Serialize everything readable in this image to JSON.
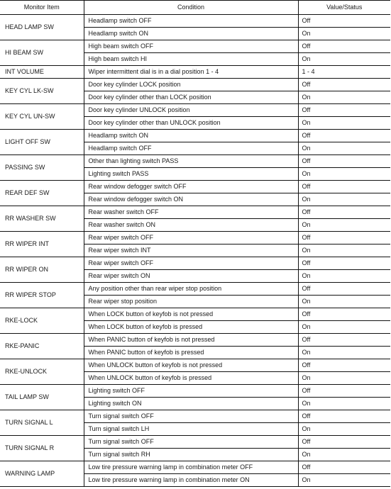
{
  "table": {
    "headers": [
      "Monitor Item",
      "Condition",
      "Value/Status"
    ],
    "groups": [
      {
        "item": "HEAD LAMP SW",
        "rows": [
          {
            "condition": "Headlamp switch OFF",
            "value": "Off"
          },
          {
            "condition": "Headlamp switch ON",
            "value": "On"
          }
        ]
      },
      {
        "item": "HI BEAM SW",
        "rows": [
          {
            "condition": "High beam switch OFF",
            "value": "Off"
          },
          {
            "condition": "High beam switch HI",
            "value": "On"
          }
        ]
      },
      {
        "item": "INT VOLUME",
        "rows": [
          {
            "condition": "Wiper intermittent dial is in a dial position 1 - 4",
            "value": "1 - 4"
          }
        ]
      },
      {
        "item": "KEY CYL LK-SW",
        "rows": [
          {
            "condition": "Door key cylinder LOCK position",
            "value": "Off"
          },
          {
            "condition": "Door key cylinder other than LOCK position",
            "value": "On"
          }
        ]
      },
      {
        "item": "KEY CYL UN-SW",
        "rows": [
          {
            "condition": "Door key cylinder UNLOCK position",
            "value": "Off"
          },
          {
            "condition": "Door key cylinder other than UNLOCK position",
            "value": "On"
          }
        ]
      },
      {
        "item": "LIGHT OFF SW",
        "rows": [
          {
            "condition": "Headlamp switch ON",
            "value": "Off"
          },
          {
            "condition": "Headlamp switch OFF",
            "value": "On"
          }
        ]
      },
      {
        "item": "PASSING SW",
        "rows": [
          {
            "condition": "Other than lighting switch PASS",
            "value": "Off"
          },
          {
            "condition": "Lighting switch PASS",
            "value": "On"
          }
        ]
      },
      {
        "item": "REAR DEF SW",
        "rows": [
          {
            "condition": "Rear window defogger switch OFF",
            "value": "Off"
          },
          {
            "condition": "Rear window defogger switch ON",
            "value": "On"
          }
        ]
      },
      {
        "item": "RR WASHER SW",
        "rows": [
          {
            "condition": "Rear washer switch OFF",
            "value": "Off"
          },
          {
            "condition": "Rear washer switch ON",
            "value": "On"
          }
        ]
      },
      {
        "item": "RR WIPER INT",
        "rows": [
          {
            "condition": "Rear wiper switch OFF",
            "value": "Off"
          },
          {
            "condition": "Rear wiper switch INT",
            "value": "On"
          }
        ]
      },
      {
        "item": "RR WIPER ON",
        "rows": [
          {
            "condition": "Rear wiper switch OFF",
            "value": "Off"
          },
          {
            "condition": "Rear wiper switch ON",
            "value": "On"
          }
        ]
      },
      {
        "item": "RR WIPER STOP",
        "rows": [
          {
            "condition": "Any position other than rear wiper stop position",
            "value": "Off"
          },
          {
            "condition": "Rear wiper stop position",
            "value": "On"
          }
        ]
      },
      {
        "item": "RKE-LOCK",
        "rows": [
          {
            "condition": "When LOCK button of keyfob is not pressed",
            "value": "Off"
          },
          {
            "condition": "When LOCK button of keyfob is pressed",
            "value": "On"
          }
        ]
      },
      {
        "item": "RKE-PANIC",
        "rows": [
          {
            "condition": "When PANIC button of keyfob is not pressed",
            "value": "Off"
          },
          {
            "condition": "When PANIC button of keyfob is pressed",
            "value": "On"
          }
        ]
      },
      {
        "item": "RKE-UNLOCK",
        "rows": [
          {
            "condition": "When UNLOCK button of keyfob is not pressed",
            "value": "Off"
          },
          {
            "condition": "When UNLOCK button of keyfob is pressed",
            "value": "On"
          }
        ]
      },
      {
        "item": "TAIL LAMP SW",
        "rows": [
          {
            "condition": "Lighting switch OFF",
            "value": "Off"
          },
          {
            "condition": "Lighting switch ON",
            "value": "On"
          }
        ]
      },
      {
        "item": "TURN SIGNAL L",
        "rows": [
          {
            "condition": "Turn signal switch OFF",
            "value": "Off"
          },
          {
            "condition": "Turn signal switch LH",
            "value": "On"
          }
        ]
      },
      {
        "item": "TURN SIGNAL R",
        "rows": [
          {
            "condition": "Turn signal switch OFF",
            "value": "Off"
          },
          {
            "condition": "Turn signal switch RH",
            "value": "On"
          }
        ]
      },
      {
        "item": "WARNING LAMP",
        "rows": [
          {
            "condition": "Low tire pressure warning lamp in combination meter OFF",
            "value": "Off"
          },
          {
            "condition": "Low tire pressure warning lamp in combination meter ON",
            "value": "On"
          }
        ]
      }
    ]
  }
}
